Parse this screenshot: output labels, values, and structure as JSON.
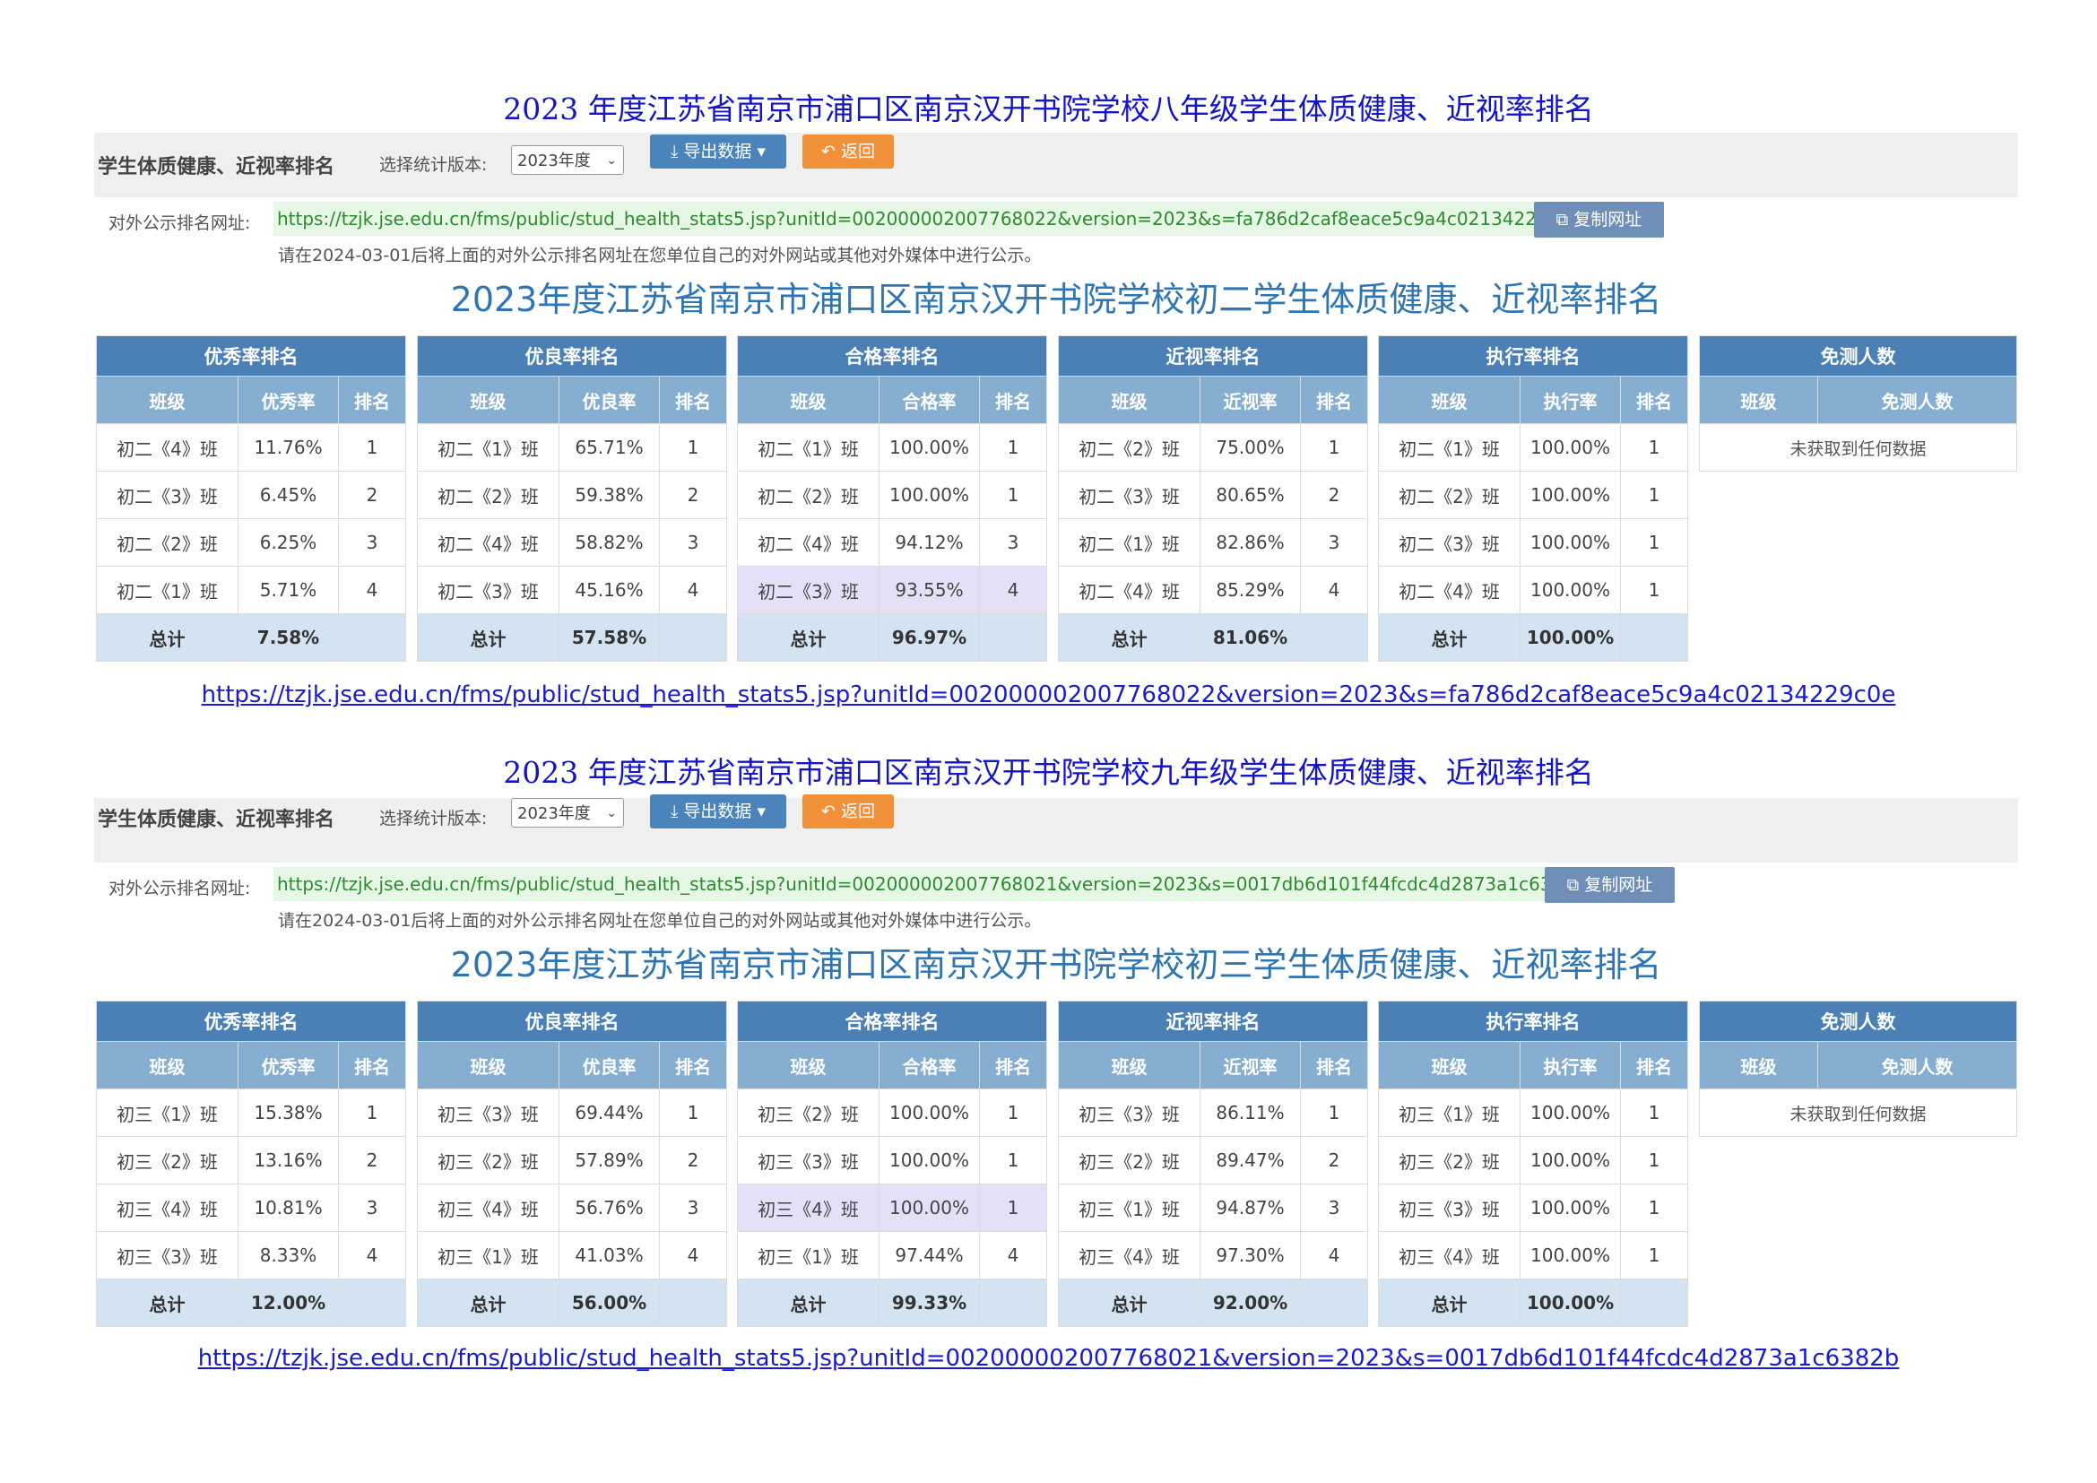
{
  "sections": [
    {
      "doc_title": "2023 年度江苏省南京市浦口区南京汉开书院学校八年级学生体质健康、近视率排名",
      "heading": "学生体质健康、近视率排名",
      "version_label": "选择统计版本:",
      "version_value": "2023年度",
      "export_label": "导出数据",
      "back_label": "返回",
      "url_label": "对外公示排名网址:",
      "url": "https://tzjk.jse.edu.cn/fms/public/stud_health_stats5.jsp?unitId=002000002007768022&version=2023&s=fa786d2caf8eace5c9a4c02134229c0e",
      "copy_label": "复制网址",
      "note": "请在2024-03-01后将上面的对外公示排名网址在您单位自己的对外网站或其他对外媒体中进行公示。",
      "page_title": "2023年度江苏省南京市浦口区南京汉开书院学校初二学生体质健康、近视率排名",
      "link": "https://tzjk.jse.edu.cn/fms/public/stud_health_stats5.jsp?unitId=002000002007768022&version=2023&s=fa786d2caf8eace5c9a4c02134229c0e",
      "tables": [
        {
          "caption": "优秀率排名",
          "headers": [
            "班级",
            "优秀率",
            "排名"
          ],
          "rows": [
            [
              "初二《4》班",
              "11.76%",
              "1"
            ],
            [
              "初二《3》班",
              "6.45%",
              "2"
            ],
            [
              "初二《2》班",
              "6.25%",
              "3"
            ],
            [
              "初二《1》班",
              "5.71%",
              "4"
            ]
          ],
          "total": [
            "总计",
            "7.58%",
            ""
          ]
        },
        {
          "caption": "优良率排名",
          "headers": [
            "班级",
            "优良率",
            "排名"
          ],
          "rows": [
            [
              "初二《1》班",
              "65.71%",
              "1"
            ],
            [
              "初二《2》班",
              "59.38%",
              "2"
            ],
            [
              "初二《4》班",
              "58.82%",
              "3"
            ],
            [
              "初二《3》班",
              "45.16%",
              "4"
            ]
          ],
          "total": [
            "总计",
            "57.58%",
            ""
          ]
        },
        {
          "caption": "合格率排名",
          "headers": [
            "班级",
            "合格率",
            "排名"
          ],
          "rows": [
            [
              "初二《1》班",
              "100.00%",
              "1"
            ],
            [
              "初二《2》班",
              "100.00%",
              "1"
            ],
            [
              "初二《4》班",
              "94.12%",
              "3"
            ],
            [
              "初二《3》班",
              "93.55%",
              "4"
            ]
          ],
          "total": [
            "总计",
            "96.97%",
            ""
          ]
        },
        {
          "caption": "近视率排名",
          "headers": [
            "班级",
            "近视率",
            "排名"
          ],
          "rows": [
            [
              "初二《2》班",
              "75.00%",
              "1"
            ],
            [
              "初二《3》班",
              "80.65%",
              "2"
            ],
            [
              "初二《1》班",
              "82.86%",
              "3"
            ],
            [
              "初二《4》班",
              "85.29%",
              "4"
            ]
          ],
          "total": [
            "总计",
            "81.06%",
            ""
          ]
        },
        {
          "caption": "执行率排名",
          "headers": [
            "班级",
            "执行率",
            "排名"
          ],
          "rows": [
            [
              "初二《1》班",
              "100.00%",
              "1"
            ],
            [
              "初二《2》班",
              "100.00%",
              "1"
            ],
            [
              "初二《3》班",
              "100.00%",
              "1"
            ],
            [
              "初二《4》班",
              "100.00%",
              "1"
            ]
          ],
          "total": [
            "总计",
            "100.00%",
            ""
          ]
        }
      ],
      "exempt": {
        "caption": "免测人数",
        "headers": [
          "班级",
          "免测人数"
        ],
        "empty": "未获取到任何数据"
      }
    },
    {
      "doc_title": "2023 年度江苏省南京市浦口区南京汉开书院学校九年级学生体质健康、近视率排名",
      "heading": "学生体质健康、近视率排名",
      "version_label": "选择统计版本:",
      "version_value": "2023年度",
      "export_label": "导出数据",
      "back_label": "返回",
      "url_label": "对外公示排名网址:",
      "url": "https://tzjk.jse.edu.cn/fms/public/stud_health_stats5.jsp?unitId=002000002007768021&version=2023&s=0017db6d101f44fcdc4d2873a1c6382b",
      "copy_label": "复制网址",
      "note": "请在2024-03-01后将上面的对外公示排名网址在您单位自己的对外网站或其他对外媒体中进行公示。",
      "page_title": "2023年度江苏省南京市浦口区南京汉开书院学校初三学生体质健康、近视率排名",
      "link": "https://tzjk.jse.edu.cn/fms/public/stud_health_stats5.jsp?unitId=002000002007768021&version=2023&s=0017db6d101f44fcdc4d2873a1c6382b",
      "tables": [
        {
          "caption": "优秀率排名",
          "headers": [
            "班级",
            "优秀率",
            "排名"
          ],
          "rows": [
            [
              "初三《1》班",
              "15.38%",
              "1"
            ],
            [
              "初三《2》班",
              "13.16%",
              "2"
            ],
            [
              "初三《4》班",
              "10.81%",
              "3"
            ],
            [
              "初三《3》班",
              "8.33%",
              "4"
            ]
          ],
          "total": [
            "总计",
            "12.00%",
            ""
          ]
        },
        {
          "caption": "优良率排名",
          "headers": [
            "班级",
            "优良率",
            "排名"
          ],
          "rows": [
            [
              "初三《3》班",
              "69.44%",
              "1"
            ],
            [
              "初三《2》班",
              "57.89%",
              "2"
            ],
            [
              "初三《4》班",
              "56.76%",
              "3"
            ],
            [
              "初三《1》班",
              "41.03%",
              "4"
            ]
          ],
          "total": [
            "总计",
            "56.00%",
            ""
          ]
        },
        {
          "caption": "合格率排名",
          "headers": [
            "班级",
            "合格率",
            "排名"
          ],
          "rows": [
            [
              "初三《2》班",
              "100.00%",
              "1"
            ],
            [
              "初三《3》班",
              "100.00%",
              "1"
            ],
            [
              "初三《4》班",
              "100.00%",
              "1"
            ],
            [
              "初三《1》班",
              "97.44%",
              "4"
            ]
          ],
          "total": [
            "总计",
            "99.33%",
            ""
          ]
        },
        {
          "caption": "近视率排名",
          "headers": [
            "班级",
            "近视率",
            "排名"
          ],
          "rows": [
            [
              "初三《3》班",
              "86.11%",
              "1"
            ],
            [
              "初三《2》班",
              "89.47%",
              "2"
            ],
            [
              "初三《1》班",
              "94.87%",
              "3"
            ],
            [
              "初三《4》班",
              "97.30%",
              "4"
            ]
          ],
          "total": [
            "总计",
            "92.00%",
            ""
          ]
        },
        {
          "caption": "执行率排名",
          "headers": [
            "班级",
            "执行率",
            "排名"
          ],
          "rows": [
            [
              "初三《1》班",
              "100.00%",
              "1"
            ],
            [
              "初三《2》班",
              "100.00%",
              "1"
            ],
            [
              "初三《3》班",
              "100.00%",
              "1"
            ],
            [
              "初三《4》班",
              "100.00%",
              "1"
            ]
          ],
          "total": [
            "总计",
            "100.00%",
            ""
          ]
        }
      ],
      "exempt": {
        "caption": "免测人数",
        "headers": [
          "班级",
          "免测人数"
        ],
        "empty": "未获取到任何数据"
      }
    }
  ]
}
